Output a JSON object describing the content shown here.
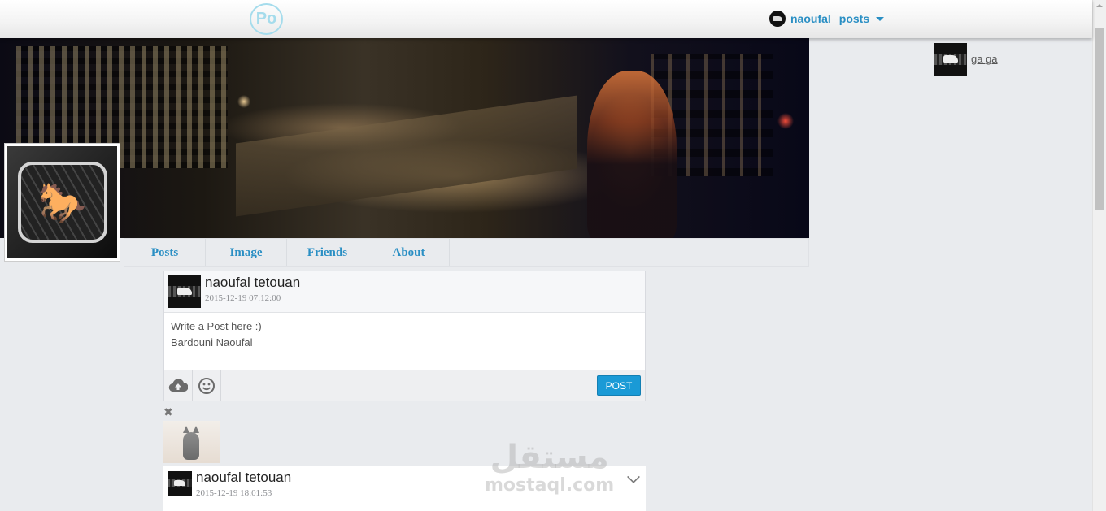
{
  "header": {
    "logo_text": "Po",
    "user_name": "naoufal",
    "posts_label": "posts"
  },
  "profile": {
    "tabs": [
      {
        "label": "Posts"
      },
      {
        "label": "Image"
      },
      {
        "label": "Friends"
      },
      {
        "label": "About"
      }
    ]
  },
  "composer": {
    "author": "naoufal tetouan",
    "date": "2015-12-19 07:12:00",
    "line1": "Write a Post here :)",
    "line2": "Bardouni Naoufal",
    "post_button": "POST",
    "upload_icon": "cloud-upload-icon",
    "emoji_icon": "smiley-icon"
  },
  "post": {
    "close_symbol": "✖",
    "author": "naoufal tetouan",
    "date": "2015-12-19 18:01:53"
  },
  "sidebar": {
    "friends": [
      {
        "name": "ga ga"
      }
    ]
  },
  "watermark": {
    "arabic": "مستقل",
    "latin": "mostaql.com"
  },
  "colors": {
    "accent": "#2a8fc4",
    "post_button": "#1a9ad6",
    "background": "#e9ebee"
  }
}
